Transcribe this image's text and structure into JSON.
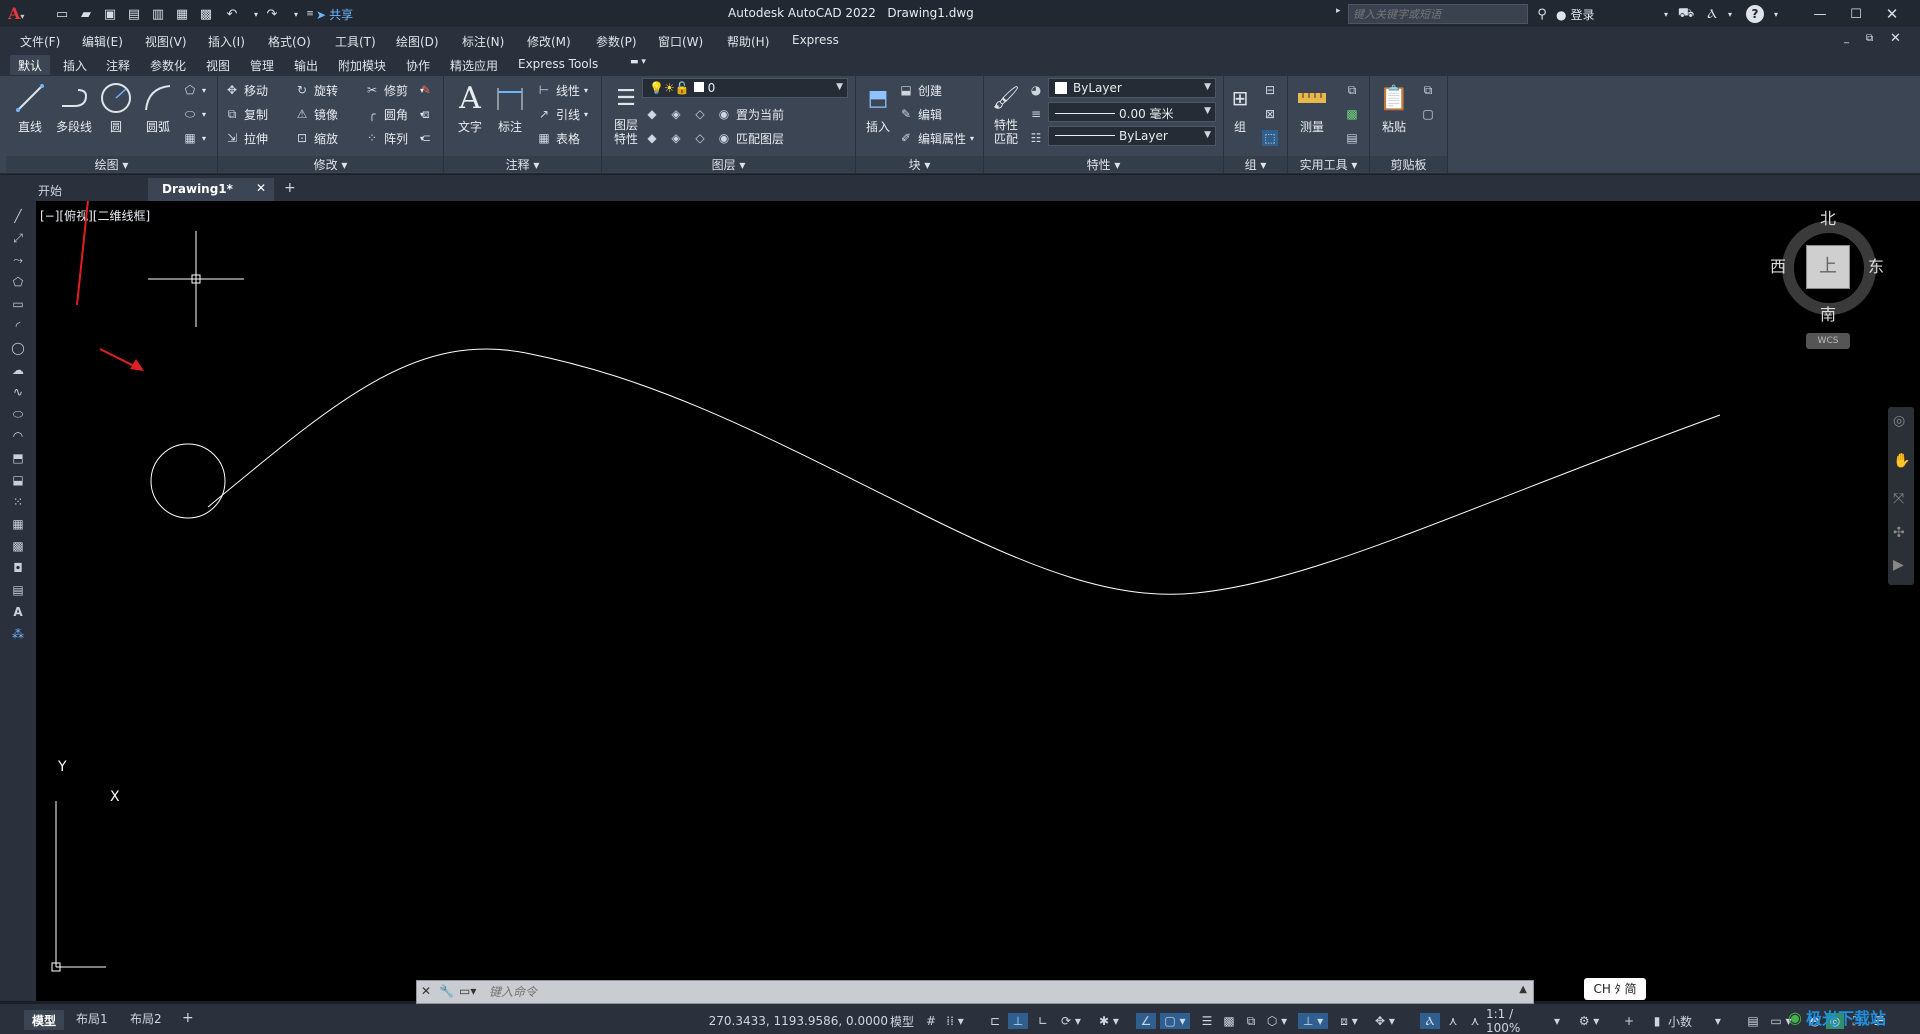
{
  "window": {
    "app_title": "Autodesk AutoCAD 2022",
    "doc_title": "Drawing1.dwg",
    "share_label": "共享",
    "search_placeholder": "键入关键字或短语",
    "login_label": "登录"
  },
  "menubar": [
    "文件(F)",
    "编辑(E)",
    "视图(V)",
    "插入(I)",
    "格式(O)",
    "工具(T)",
    "绘图(D)",
    "标注(N)",
    "修改(M)",
    "参数(P)",
    "窗口(W)",
    "帮助(H)",
    "Express"
  ],
  "ribbon_tabs": [
    "默认",
    "插入",
    "注释",
    "参数化",
    "视图",
    "管理",
    "输出",
    "附加模块",
    "协作",
    "精选应用",
    "Express Tools"
  ],
  "ribbon": {
    "draw": {
      "title": "绘图",
      "line": "直线",
      "polyline": "多段线",
      "circle": "圆",
      "arc": "圆弧"
    },
    "modify": {
      "title": "修改",
      "move": "移动",
      "rotate": "旋转",
      "trim": "修剪",
      "copy": "复制",
      "mirror": "镜像",
      "fillet": "圆角",
      "stretch": "拉伸",
      "scale": "缩放",
      "array": "阵列"
    },
    "annotation": {
      "title": "注释",
      "text": "文字",
      "dimension": "标注",
      "linear": "线性",
      "leader": "引线",
      "table": "表格"
    },
    "layers": {
      "title": "图层",
      "layer_props": "图层特性",
      "layer_value": "0",
      "set_current": "置为当前",
      "match_layer": "匹配图层"
    },
    "block": {
      "title": "块",
      "insert": "插入",
      "create": "创建",
      "edit": "编辑",
      "edit_attr": "编辑属性"
    },
    "properties": {
      "title": "特性",
      "match": "特性匹配",
      "color": "ByLayer",
      "lineweight": "0.00 毫米",
      "linetype": "ByLayer"
    },
    "groups": {
      "title": "组",
      "group": "组"
    },
    "utilities": {
      "title": "实用工具",
      "measure": "测量"
    },
    "clipboard": {
      "title": "剪贴板",
      "paste": "粘贴"
    }
  },
  "file_tabs": {
    "start": "开始",
    "drawing": "Drawing1*",
    "add": "+"
  },
  "viewport": {
    "label": "[−][俯视][二维线框]",
    "viewcube": {
      "north": "北",
      "south": "南",
      "east": "东",
      "west": "西",
      "top": "上",
      "wcs": "WCS"
    },
    "ucs": {
      "x": "X",
      "y": "Y"
    }
  },
  "command": {
    "placeholder": "键入命令"
  },
  "ime": "CH ﾀ 简",
  "layout_tabs": {
    "model": "模型",
    "layout1": "布局1",
    "layout2": "布局2",
    "add": "+"
  },
  "status": {
    "coords": "270.3433, 1193.9586, 0.0000",
    "model": "模型",
    "scale": "1:1 / 100%",
    "units": "小数"
  },
  "watermark": "极光下载站"
}
